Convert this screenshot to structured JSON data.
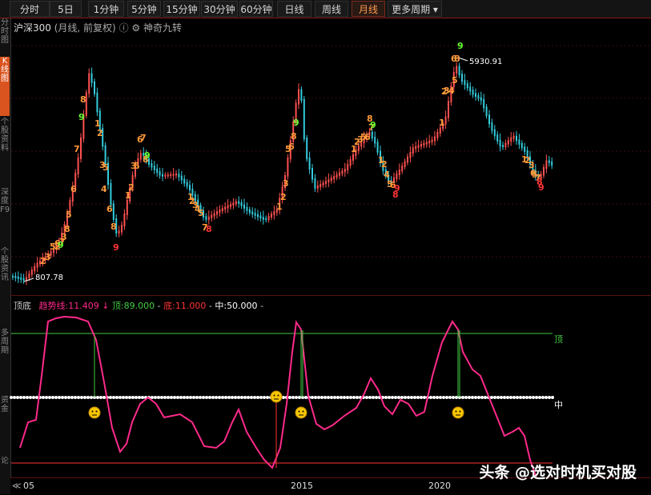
{
  "toolbar": {
    "tabs": [
      {
        "label": "分时"
      },
      {
        "label": "5日"
      },
      {
        "label": "1分钟"
      },
      {
        "label": "5分钟"
      },
      {
        "label": "15分钟"
      },
      {
        "label": "30分钟"
      },
      {
        "label": "60分钟"
      },
      {
        "label": "日线"
      },
      {
        "label": "周线"
      },
      {
        "label": "月线",
        "active": true
      },
      {
        "label": "更多周期"
      }
    ]
  },
  "sidebar": {
    "items": [
      {
        "label": "分时图"
      },
      {
        "label": "K线图",
        "active": true
      },
      {
        "label": "个股资料"
      },
      {
        "label": "深度F9"
      },
      {
        "label": "个股资讯"
      },
      {
        "label": "多周期"
      },
      {
        "label": "资金"
      },
      {
        "label": "论"
      }
    ]
  },
  "chart": {
    "symbol": "沪深300",
    "mode": "(月线, 前复权)",
    "indicator_name": "神奇九转",
    "high_label": "5930.91",
    "low_label": "807.78",
    "tags": [
      {
        "t": "2",
        "c": "orange"
      },
      {
        "t": "3",
        "c": "orange"
      },
      {
        "t": "5",
        "c": "orange"
      },
      {
        "t": "6",
        "c": "orange"
      },
      {
        "t": "7",
        "c": "orange"
      },
      {
        "t": "8",
        "c": "orange"
      },
      {
        "t": "9",
        "c": "green"
      },
      {
        "t": "2",
        "c": "orange"
      },
      {
        "t": "3",
        "c": "orange"
      },
      {
        "t": "5",
        "c": "orange"
      },
      {
        "t": "6",
        "c": "orange"
      },
      {
        "t": "7",
        "c": "orange"
      },
      {
        "t": "8",
        "c": "orange"
      },
      {
        "t": "9",
        "c": "green"
      },
      {
        "t": "1",
        "c": "orange"
      },
      {
        "t": "2",
        "c": "orange"
      },
      {
        "t": "3",
        "c": "orange"
      },
      {
        "t": "5",
        "c": "orange"
      },
      {
        "t": "4",
        "c": "orange"
      },
      {
        "t": "6",
        "c": "orange"
      },
      {
        "t": "8",
        "c": "orange"
      },
      {
        "t": "9",
        "c": "red"
      },
      {
        "t": "1",
        "c": "orange"
      },
      {
        "t": "2",
        "c": "orange"
      },
      {
        "t": "3",
        "c": "orange"
      },
      {
        "t": "5",
        "c": "orange"
      },
      {
        "t": "6",
        "c": "orange"
      },
      {
        "t": "7",
        "c": "orange"
      },
      {
        "t": "8",
        "c": "orange"
      },
      {
        "t": "9",
        "c": "green"
      },
      {
        "t": "1",
        "c": "orange"
      },
      {
        "t": "2",
        "c": "orange"
      },
      {
        "t": "3",
        "c": "orange"
      },
      {
        "t": "4",
        "c": "orange"
      },
      {
        "t": "5",
        "c": "orange"
      },
      {
        "t": "7",
        "c": "orange"
      },
      {
        "t": "8",
        "c": "red"
      },
      {
        "t": "1",
        "c": "orange"
      },
      {
        "t": "2",
        "c": "orange"
      },
      {
        "t": "3",
        "c": "orange"
      },
      {
        "t": "5",
        "c": "orange"
      },
      {
        "t": "6",
        "c": "orange"
      },
      {
        "t": "8",
        "c": "orange"
      },
      {
        "t": "9",
        "c": "green"
      },
      {
        "t": "1",
        "c": "orange"
      },
      {
        "t": "2",
        "c": "orange"
      },
      {
        "t": "3",
        "c": "orange"
      },
      {
        "t": "5",
        "c": "orange"
      },
      {
        "t": "6",
        "c": "orange"
      },
      {
        "t": "7",
        "c": "orange"
      },
      {
        "t": "8",
        "c": "orange"
      },
      {
        "t": "9",
        "c": "green"
      },
      {
        "t": "1",
        "c": "orange"
      },
      {
        "t": "2",
        "c": "orange"
      },
      {
        "t": "4",
        "c": "orange"
      },
      {
        "t": "5",
        "c": "orange"
      },
      {
        "t": "6",
        "c": "orange"
      },
      {
        "t": "8",
        "c": "red"
      },
      {
        "t": "9",
        "c": "red"
      },
      {
        "t": "1",
        "c": "orange"
      },
      {
        "t": "2",
        "c": "orange"
      },
      {
        "t": "3",
        "c": "orange"
      },
      {
        "t": "4",
        "c": "orange"
      },
      {
        "t": "5",
        "c": "orange"
      },
      {
        "t": "6",
        "c": "orange"
      },
      {
        "t": "8",
        "c": "orange"
      },
      {
        "t": "9",
        "c": "green"
      },
      {
        "t": "1",
        "c": "orange"
      },
      {
        "t": "2",
        "c": "orange"
      },
      {
        "t": "3",
        "c": "orange"
      },
      {
        "t": "5",
        "c": "orange"
      },
      {
        "t": "6",
        "c": "orange"
      },
      {
        "t": "7",
        "c": "orange"
      },
      {
        "t": "8",
        "c": "red"
      },
      {
        "t": "9",
        "c": "red"
      }
    ]
  },
  "indicator": {
    "name": "顶底",
    "trend_label": "趋势线:",
    "trend_value": "11.409",
    "top_label": "顶:",
    "top_value": "89.000",
    "bottom_label": "底:",
    "bottom_value": "11.000",
    "mid_label": "中:",
    "mid_value": "50.000",
    "right_top": "顶",
    "right_mid": "中"
  },
  "xaxis": {
    "labels": [
      "05",
      "2015",
      "2020"
    ],
    "nav": "≪"
  },
  "watermark": "头条 @选对时机买对股",
  "colors": {
    "up": "#ff5050",
    "down": "#33ccdd",
    "orange": "#ff9a3a",
    "green": "#66ff33",
    "trend": "#ff2a8a",
    "top": "#44cc44",
    "bottom": "#ff3333"
  }
}
